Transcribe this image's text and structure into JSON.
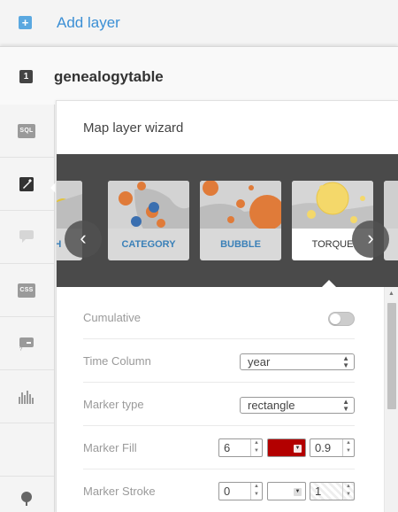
{
  "add_layer": {
    "icon": "plus-icon",
    "label": "Add layer"
  },
  "layer": {
    "number": "1",
    "name": "genealogytable"
  },
  "rail": {
    "items": [
      {
        "name": "sql-icon",
        "badge": "SQL"
      },
      {
        "name": "wizard-brush-icon",
        "active": true
      },
      {
        "name": "infowindow-icon"
      },
      {
        "name": "css-icon",
        "badge": "CSS"
      },
      {
        "name": "legend-icon"
      },
      {
        "name": "histogram-icon"
      },
      {
        "name": "empty"
      },
      {
        "name": "pin-icon"
      }
    ]
  },
  "wizard": {
    "title": "Map layer wizard",
    "cards": [
      {
        "label": "OPLETH"
      },
      {
        "label": "CATEGORY"
      },
      {
        "label": "BUBBLE"
      },
      {
        "label": "TORQUE",
        "selected": true
      },
      {
        "label": ""
      }
    ],
    "prev_icon": "‹",
    "next_icon": "›"
  },
  "form": {
    "cumulative": {
      "label": "Cumulative",
      "on": false
    },
    "time_column": {
      "label": "Time Column",
      "value": "year"
    },
    "marker_type": {
      "label": "Marker type",
      "value": "rectangle"
    },
    "marker_fill": {
      "label": "Marker Fill",
      "size": "6",
      "color": "#b30000",
      "opacity": "0.9"
    },
    "marker_stroke": {
      "label": "Marker Stroke",
      "width": "0",
      "color": "#ffffff",
      "opacity": "1"
    }
  },
  "colors": {
    "accent": "#3b8fd5",
    "carousel_bg": "#4a4a4a"
  }
}
